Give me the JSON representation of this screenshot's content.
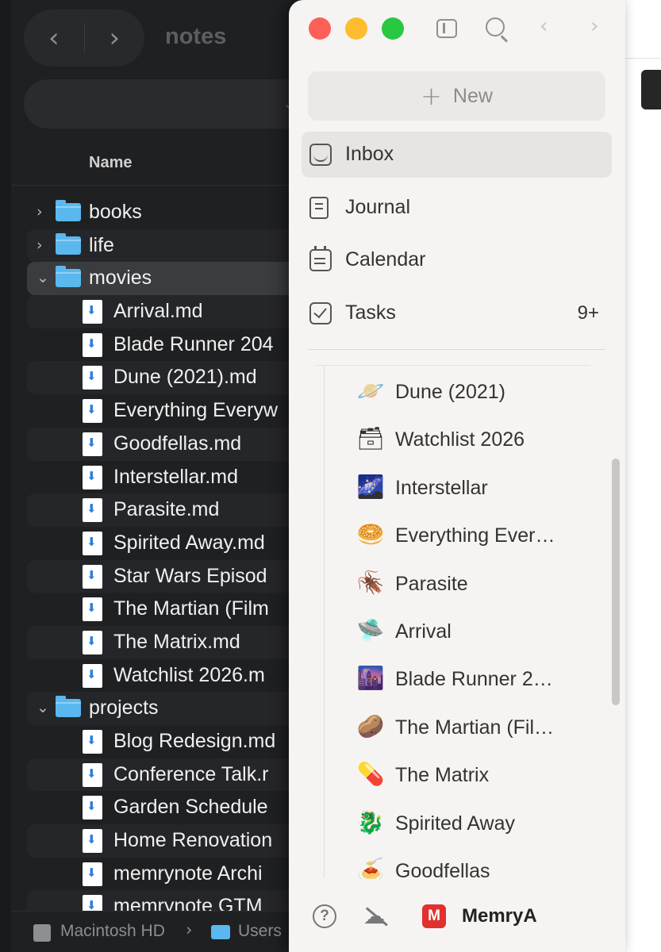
{
  "finder": {
    "title": "notes",
    "back_glyph": "‹",
    "forward_glyph": "›",
    "column_header": "Name",
    "rows": [
      {
        "type": "folder",
        "expanded": false,
        "label": "books"
      },
      {
        "type": "folder",
        "expanded": false,
        "label": "life"
      },
      {
        "type": "folder",
        "expanded": true,
        "label": "movies",
        "selected": true
      },
      {
        "type": "file",
        "label": "Arrival.md"
      },
      {
        "type": "file",
        "label": "Blade Runner 204"
      },
      {
        "type": "file",
        "label": "Dune (2021).md"
      },
      {
        "type": "file",
        "label": "Everything Everyw"
      },
      {
        "type": "file",
        "label": "Goodfellas.md"
      },
      {
        "type": "file",
        "label": "Interstellar.md"
      },
      {
        "type": "file",
        "label": "Parasite.md"
      },
      {
        "type": "file",
        "label": "Spirited Away.md"
      },
      {
        "type": "file",
        "label": "Star Wars Episod"
      },
      {
        "type": "file",
        "label": "The Martian (Film"
      },
      {
        "type": "file",
        "label": "The Matrix.md"
      },
      {
        "type": "file",
        "label": "Watchlist 2026.m"
      },
      {
        "type": "folder",
        "expanded": true,
        "label": "projects"
      },
      {
        "type": "file",
        "label": "Blog Redesign.md"
      },
      {
        "type": "file",
        "label": "Conference Talk.r"
      },
      {
        "type": "file",
        "label": "Garden Schedule"
      },
      {
        "type": "file",
        "label": "Home Renovation"
      },
      {
        "type": "file",
        "label": "memrynote Archi"
      },
      {
        "type": "file",
        "label": "memrynote GTM"
      }
    ],
    "path": {
      "disk": "Macintosh HD",
      "separator": "›",
      "folder": "Users"
    }
  },
  "app": {
    "new_button": {
      "plus": "+",
      "label": "New"
    },
    "nav": [
      {
        "id": "inbox",
        "label": "Inbox",
        "icon": "inbox-icon",
        "active": true
      },
      {
        "id": "journal",
        "label": "Journal",
        "icon": "journal-icon"
      },
      {
        "id": "calendar",
        "label": "Calendar",
        "icon": "calendar-icon"
      },
      {
        "id": "tasks",
        "label": "Tasks",
        "icon": "tasks-icon",
        "badge": "9+"
      }
    ],
    "pages": [
      {
        "emoji": "🪐",
        "label": "Dune (2021)"
      },
      {
        "emoji": "🗃",
        "label": "Watchlist 2026"
      },
      {
        "emoji": "🌌",
        "label": "Interstellar"
      },
      {
        "emoji": "🥯",
        "label": "Everything Ever…"
      },
      {
        "emoji": "🪳",
        "label": "Parasite"
      },
      {
        "emoji": "🛸",
        "label": "Arrival"
      },
      {
        "emoji": "🌆",
        "label": "Blade Runner 2…"
      },
      {
        "emoji": "🥔",
        "label": "The Martian (Fil…"
      },
      {
        "emoji": "💊",
        "label": "The Matrix"
      },
      {
        "emoji": "🐉",
        "label": "Spirited Away"
      },
      {
        "emoji": "🍝",
        "label": "Goodfellas"
      }
    ],
    "footer": {
      "help": "?",
      "workspace_initial": "M",
      "workspace_name": "MemryA"
    },
    "colors": {
      "close": "#fe5f57",
      "minimize": "#febc2e",
      "zoom": "#28c840",
      "workspace_badge": "#e0312f"
    }
  }
}
